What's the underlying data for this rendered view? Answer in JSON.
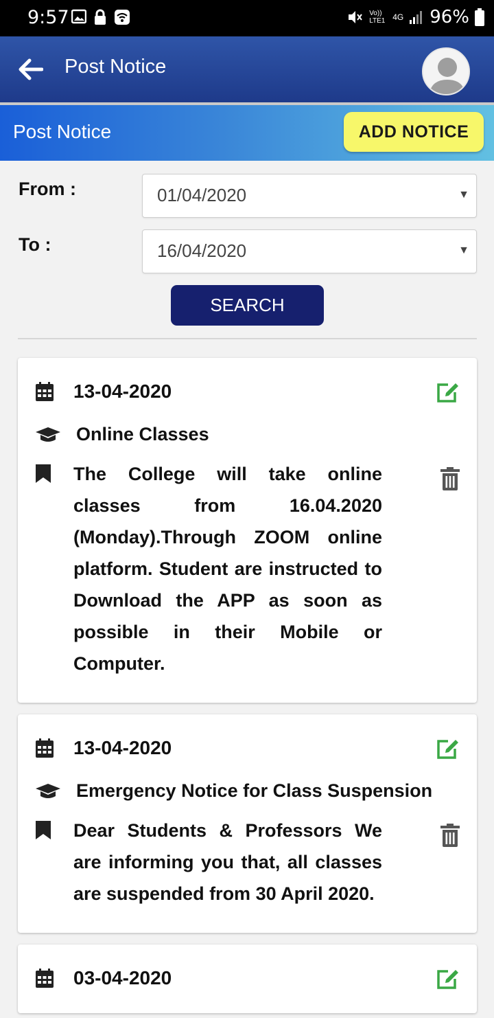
{
  "status_bar": {
    "time": "9:57",
    "battery": "96%",
    "network": "4G",
    "volte": "Vo)) LTE1"
  },
  "app_bar": {
    "title": "Post Notice",
    "back_icon": "arrow-left-icon",
    "avatar_icon": "user-avatar-icon"
  },
  "header_band": {
    "title": "Post Notice",
    "add_button": "ADD NOTICE"
  },
  "filters": {
    "from_label": "From :",
    "from_value": "01/04/2020",
    "to_label": "To :",
    "to_value": "16/04/2020",
    "search_button": "SEARCH"
  },
  "notices": [
    {
      "date": "13-04-2020",
      "title": "Online Classes",
      "body": "The College will take online classes from 16.04.2020 (Monday).Through ZOOM online platform. Student are instructed to Download the APP as soon as possible in their Mobile or Computer."
    },
    {
      "date": "13-04-2020",
      "title": "Emergency Notice for Class Suspension",
      "body": "Dear Students & Professors We are informing you that, all classes are suspended from 30 April 2020."
    },
    {
      "date": "03-04-2020",
      "title": "",
      "body": ""
    }
  ],
  "colors": {
    "app_bar": "#2f55a8",
    "add_button": "#f7f76a",
    "search_button": "#16206e",
    "edit_icon": "#3aa845",
    "delete_icon": "#555555"
  }
}
